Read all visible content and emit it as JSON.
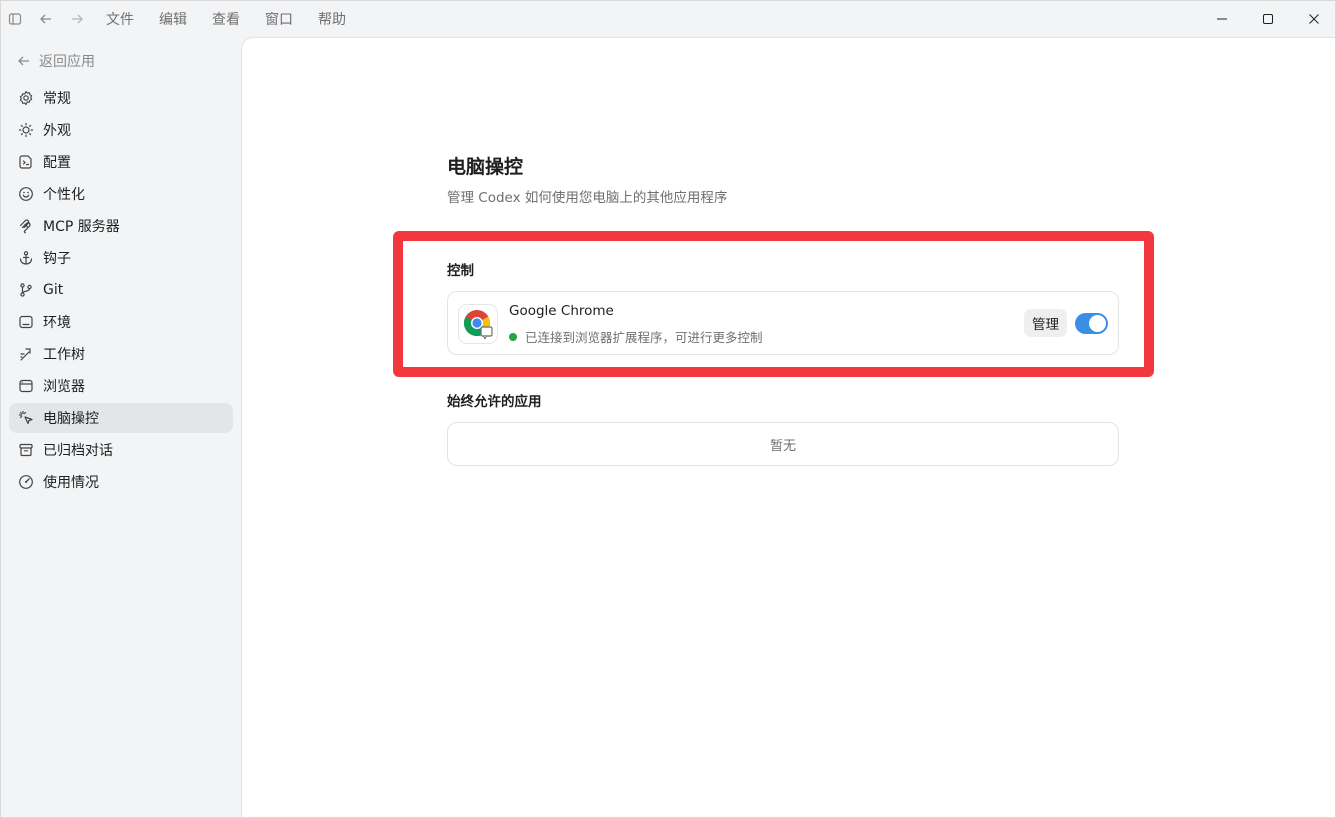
{
  "menu": [
    "文件",
    "编辑",
    "查看",
    "窗口",
    "帮助"
  ],
  "sidebar": {
    "back_label": "返回应用",
    "items": [
      {
        "label": "常规",
        "icon": "gear-icon"
      },
      {
        "label": "外观",
        "icon": "sun-icon"
      },
      {
        "label": "配置",
        "icon": "config-icon"
      },
      {
        "label": "个性化",
        "icon": "smile-icon"
      },
      {
        "label": "MCP 服务器",
        "icon": "mcp-icon"
      },
      {
        "label": "钩子",
        "icon": "anchor-icon"
      },
      {
        "label": "Git",
        "icon": "git-branch-icon"
      },
      {
        "label": "环境",
        "icon": "monitor-icon"
      },
      {
        "label": "工作树",
        "icon": "worktree-icon"
      },
      {
        "label": "浏览器",
        "icon": "browser-icon"
      },
      {
        "label": "电脑操控",
        "icon": "pointer-click-icon",
        "active": true
      },
      {
        "label": "已归档对话",
        "icon": "archive-icon"
      },
      {
        "label": "使用情况",
        "icon": "gauge-icon"
      }
    ]
  },
  "page": {
    "title": "电脑操控",
    "subtitle": "管理 Codex 如何使用您电脑上的其他应用程序"
  },
  "control_section": {
    "label": "控制",
    "app": {
      "name": "Google Chrome",
      "status": "已连接到浏览器扩展程序，可进行更多控制",
      "status_color": "#22a447",
      "manage_label": "管理",
      "enabled": true
    }
  },
  "allowed_section": {
    "label": "始终允许的应用",
    "empty_text": "暂无"
  },
  "colors": {
    "highlight": "#f2383e",
    "toggle_on": "#3a8ee6"
  }
}
